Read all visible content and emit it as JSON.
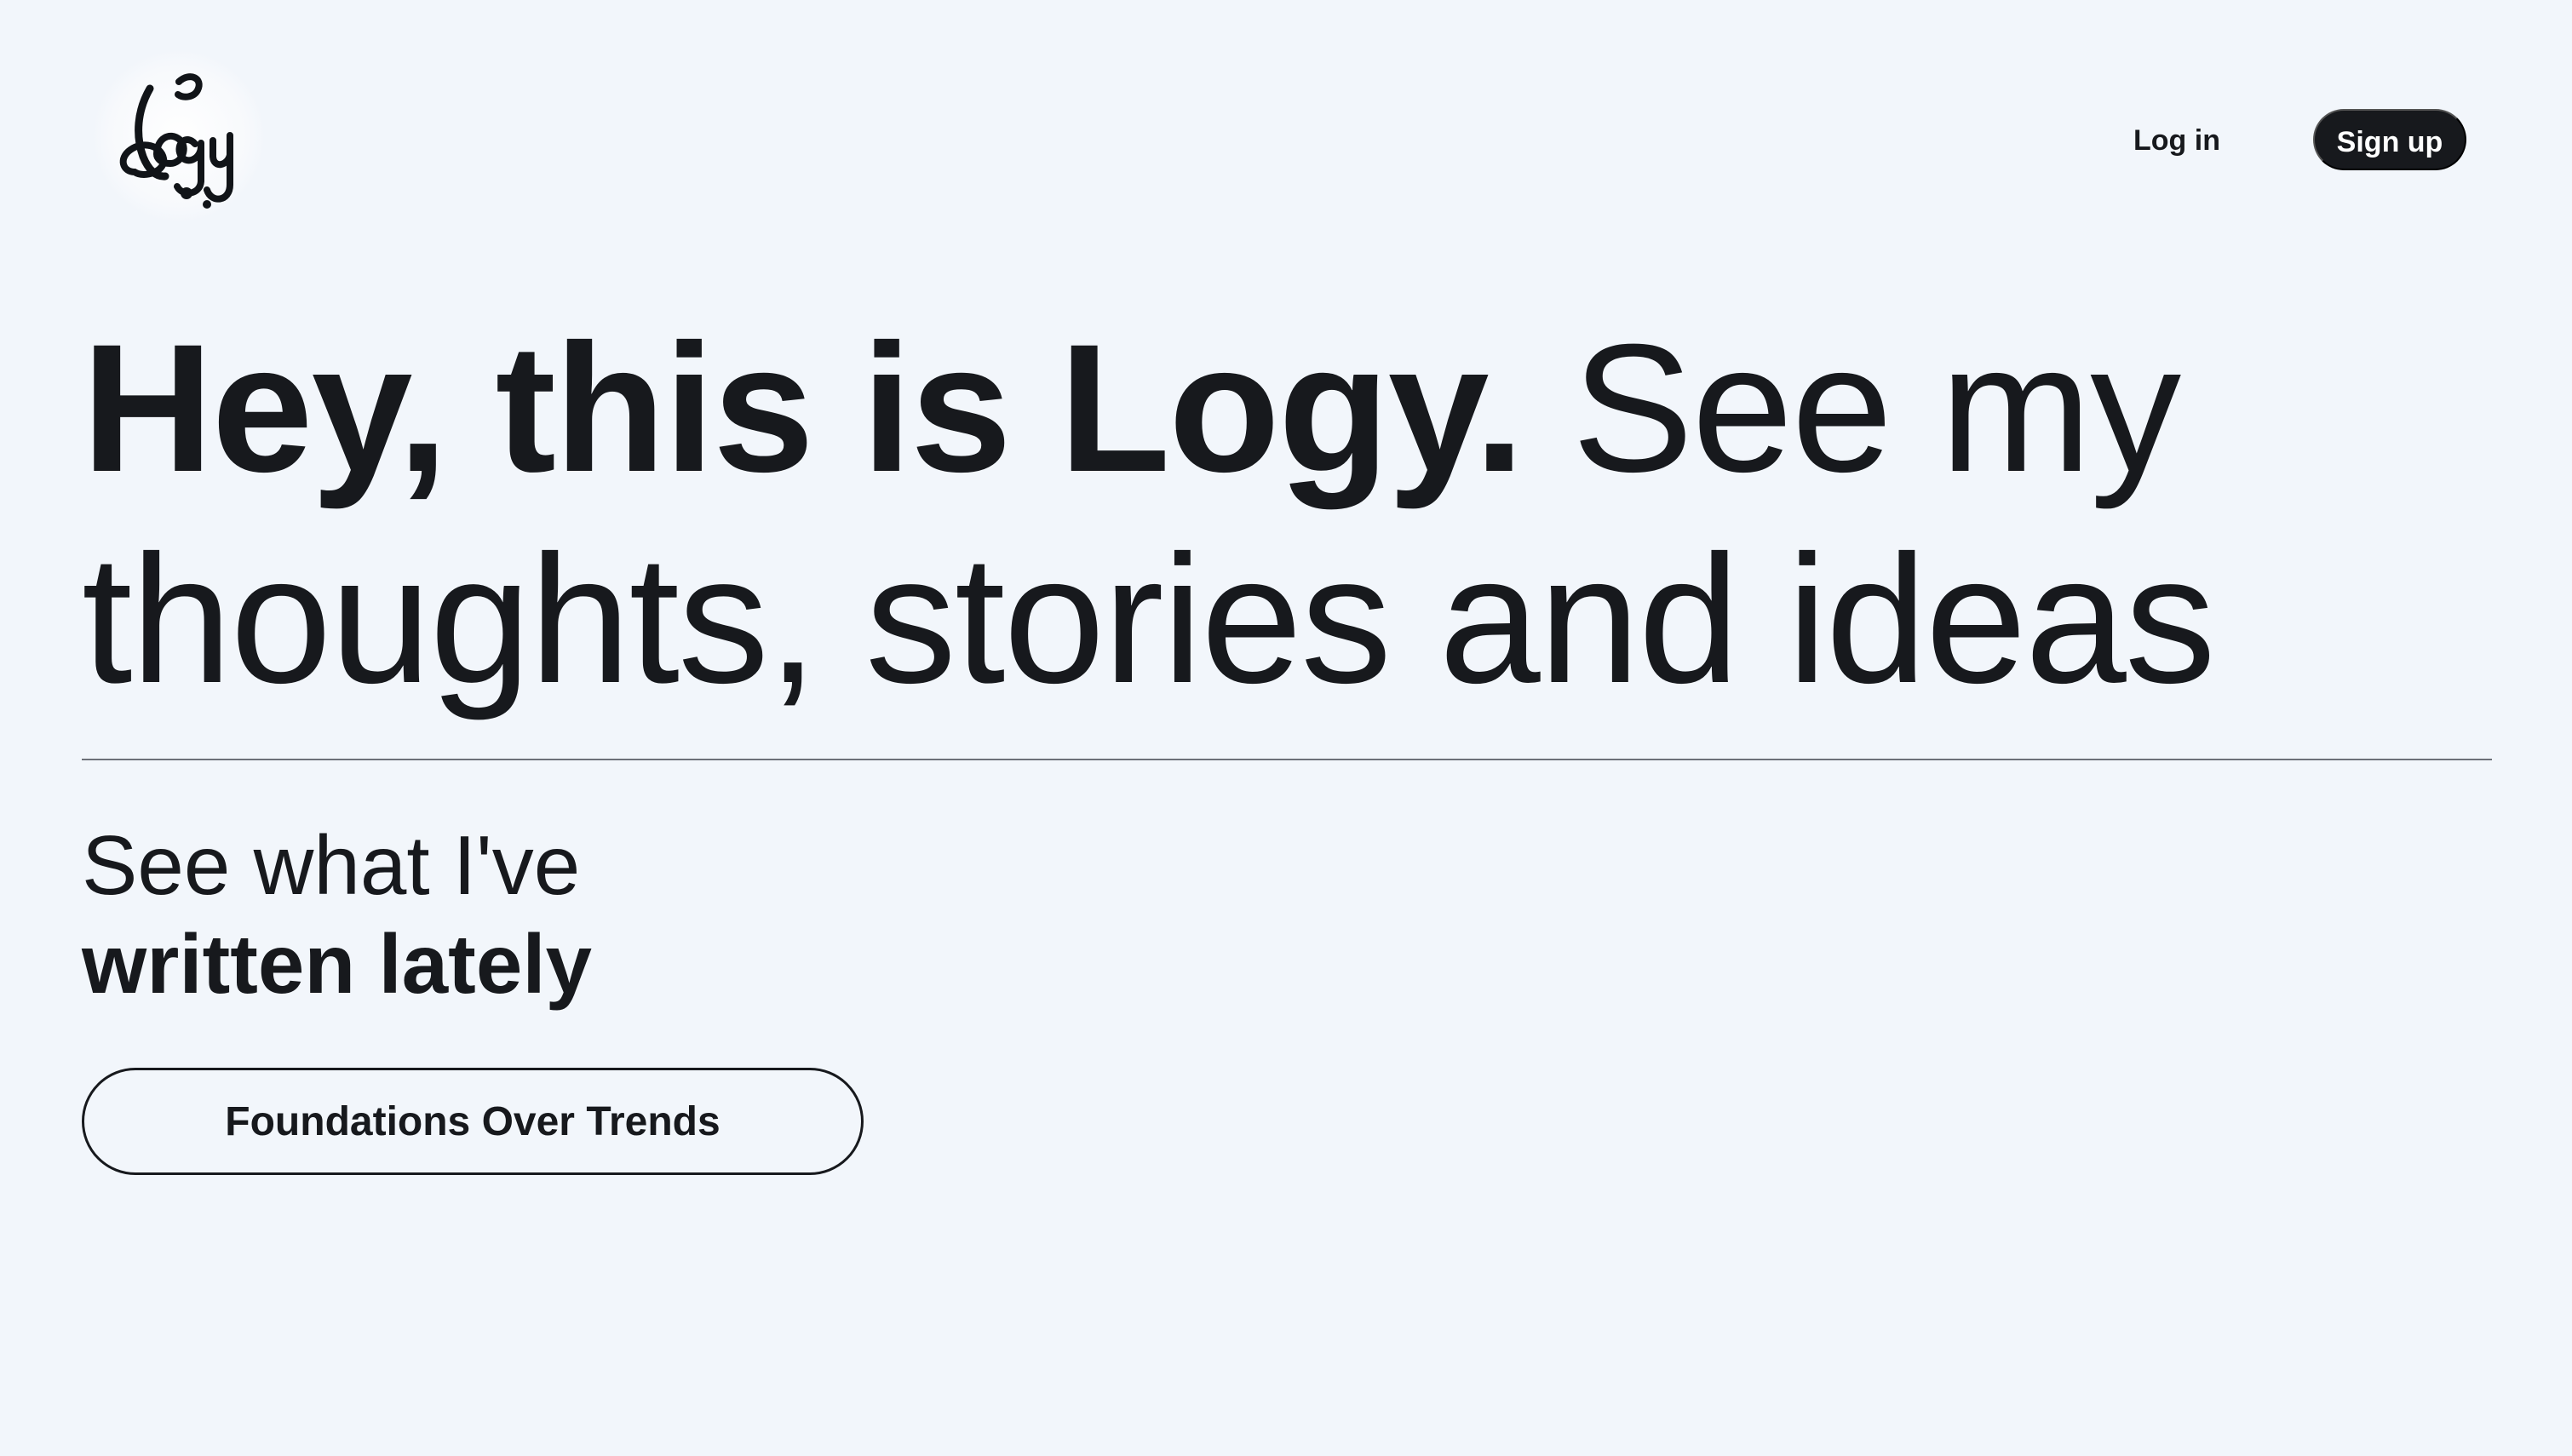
{
  "header": {
    "logo_text": "Logy",
    "login_label": "Log in",
    "signup_label": "Sign up"
  },
  "hero": {
    "strong_text": "Hey, this is Logy.",
    "normal_text": "See my thoughts, stories and ideas"
  },
  "recent": {
    "heading_light": "See what I've",
    "heading_bold": "written lately",
    "posts": [
      {
        "title": "Foundations Over Trends"
      }
    ]
  },
  "colors": {
    "background": "#f2f6fb",
    "text": "#17191d",
    "primary_button": "#17191d",
    "divider": "#6d7178"
  },
  "icons": {
    "logo": "logy-script-logo"
  }
}
